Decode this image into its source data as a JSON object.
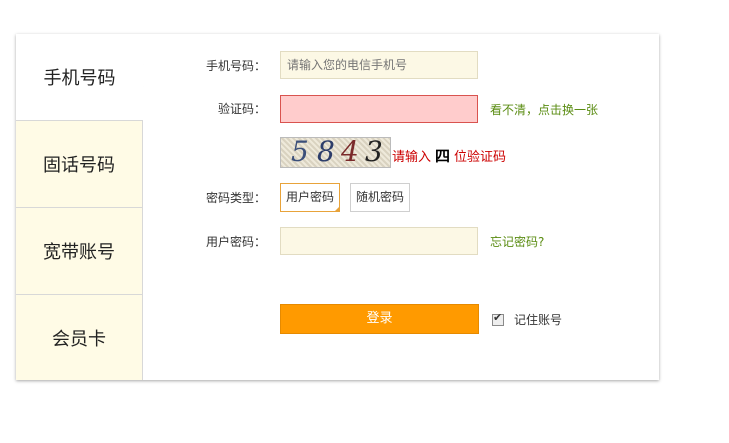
{
  "tabs": [
    {
      "label": "手机号码",
      "active": true
    },
    {
      "label": "固话号码",
      "active": false
    },
    {
      "label": "宽带账号",
      "active": false
    },
    {
      "label": "会员卡",
      "active": false
    }
  ],
  "form": {
    "phone": {
      "label": "手机号码：",
      "placeholder": "请输入您的电信手机号",
      "value": ""
    },
    "captcha": {
      "label": "验证码：",
      "value": "",
      "refresh_link": "看不清，点击换一张",
      "image_text": [
        "5",
        "8",
        "4",
        "3"
      ],
      "hint_prefix": "请输入",
      "hint_count": "四",
      "hint_suffix": "位验证码"
    },
    "password_type": {
      "label": "密码类型：",
      "options": [
        "用户密码",
        "随机密码"
      ],
      "selected": "用户密码"
    },
    "password": {
      "label": "用户密码：",
      "value": "",
      "forgot_link": "忘记密码?"
    },
    "login_button": "登录",
    "remember": {
      "label": "记住账号",
      "checked": true
    }
  },
  "colors": {
    "accent": "#ff9a00",
    "link": "#5a8c12",
    "error": "#cc0000",
    "tab_bg": "#fffbe6"
  }
}
